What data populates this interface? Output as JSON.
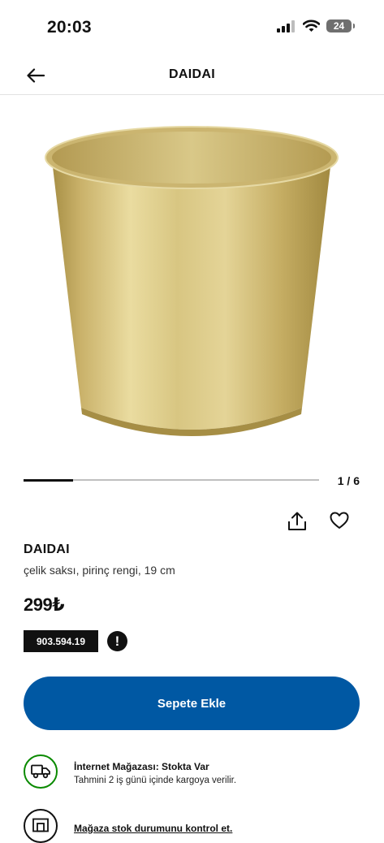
{
  "status_bar": {
    "time": "20:03",
    "battery_level": "24",
    "icons": [
      "signal-icon",
      "wifi-icon",
      "battery-icon"
    ]
  },
  "nav": {
    "title": "DAIDAI",
    "back_icon": "arrow-left-icon"
  },
  "gallery": {
    "counter": "1 / 6",
    "current_index": 1,
    "total_images": 6,
    "progress_fraction": 0.167
  },
  "actions": {
    "share_icon": "share-icon",
    "favorite_icon": "heart-icon"
  },
  "product": {
    "name": "DAIDAI",
    "description": "çelik saksı, pirinç rengi, 19 cm",
    "price": "299₺",
    "article_number": "903.594.19",
    "info_icon": "alert-icon"
  },
  "cart": {
    "button_label": "Sepete Ekle"
  },
  "availability": {
    "online": {
      "title": "İnternet Mağazası: Stokta Var",
      "subtitle": "Tahmini 2 iş günü içinde kargoya verilir.",
      "icon": "truck-icon"
    },
    "store": {
      "link": "Mağaza stok durumunu kontrol et.",
      "icon": "store-icon"
    }
  },
  "colors": {
    "primary_blue": "#0058a3",
    "stock_green": "#0a8a00",
    "text_dark": "#111111"
  }
}
